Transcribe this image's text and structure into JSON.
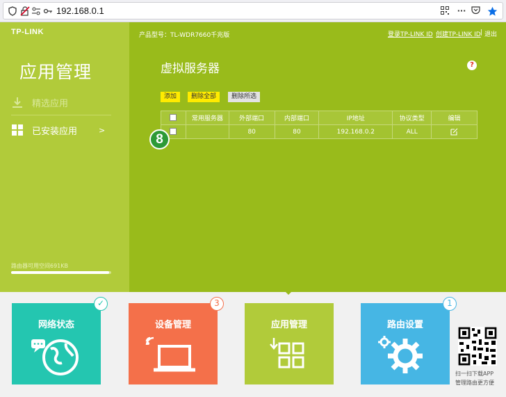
{
  "browser": {
    "url": "192.168.0.1"
  },
  "header": {
    "logo": "TP-LINK",
    "model": "产品型号：TL-WDR7660千兆版",
    "login_link": "登录TP-LINK ID",
    "create_link": "创建TP-LINK ID",
    "logout": "退出",
    "separator": "|"
  },
  "sidebar": {
    "title": "应用管理",
    "items": [
      {
        "label": "精选应用",
        "icon": "download-icon"
      },
      {
        "label": "已安装应用",
        "icon": "grid-icon",
        "arrow": ">"
      }
    ],
    "storage_label": "路由器可用空间691KB",
    "storage_fraction": 0.98
  },
  "main": {
    "title": "虚拟服务器",
    "help": "?",
    "buttons": {
      "add": "添加",
      "delete_all": "删除全部",
      "delete_selected": "删除所选"
    },
    "table": {
      "headers": [
        "",
        "常用服务器",
        "外部端口",
        "内部端口",
        "IP地址",
        "协议类型",
        "编辑"
      ],
      "rows": [
        {
          "service": "",
          "ext_port": "80",
          "int_port": "80",
          "ip": "192.168.0.2",
          "protocol": "ALL"
        }
      ]
    },
    "step_badge": "8"
  },
  "bottom": {
    "tiles": [
      {
        "label": "网络状态",
        "color": "#24c6b0",
        "badge": "✓",
        "badge_color": "#24c6b0"
      },
      {
        "label": "设备管理",
        "color": "#f4704a",
        "badge": "3",
        "badge_color": "#f4704a"
      },
      {
        "label": "应用管理",
        "color": "#b1cb3a",
        "badge": "",
        "badge_color": ""
      },
      {
        "label": "路由设置",
        "color": "#46b6e4",
        "badge": "1",
        "badge_color": "#46b6e4"
      }
    ],
    "qr_line1": "扫一扫下载APP",
    "qr_line2": "管理路由更方便"
  }
}
